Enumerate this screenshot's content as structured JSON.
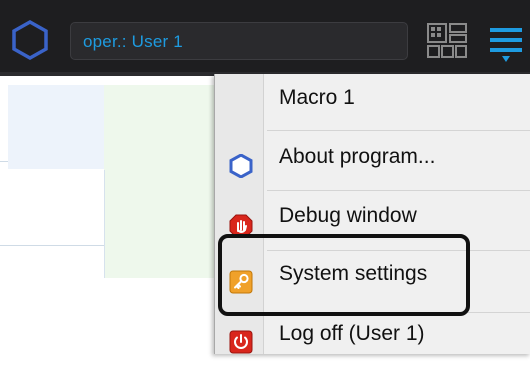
{
  "header": {
    "operator_field": "oper.: User 1",
    "logo_icon": "hexagon-logo-icon",
    "layout_icon": "layout-grid-icon",
    "menu_icon": "hamburger-menu-icon",
    "accent_color": "#1e9be0"
  },
  "menu": {
    "items": [
      {
        "label": "Macro 1",
        "icon": ""
      },
      {
        "label": "About program...",
        "icon": "hexagon-info-icon"
      },
      {
        "label": "Debug window",
        "icon": "red-hand-stop-icon"
      },
      {
        "label": "System settings",
        "icon": "key-settings-icon"
      },
      {
        "label": "Log off (User 1)",
        "icon": "power-logoff-icon"
      }
    ],
    "highlighted_item": "System settings"
  }
}
